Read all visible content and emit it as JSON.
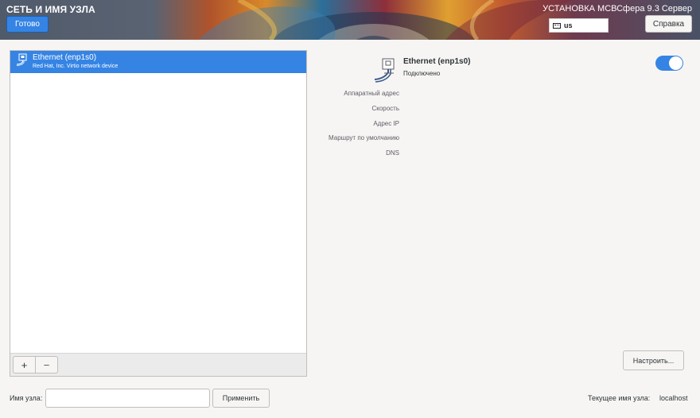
{
  "header": {
    "page_title": "СЕТЬ И ИМЯ УЗЛА",
    "done_label": "Готово",
    "product_title": "УСТАНОВКА МСВСфера 9.3 Сервер",
    "keyboard_layout": "us",
    "help_label": "Справка"
  },
  "devices": [
    {
      "name": "Ethernet (enp1s0)",
      "description": "Red Hat, Inc. Virtio network device",
      "selected": true
    }
  ],
  "list_toolbar": {
    "add_label": "+",
    "remove_label": "−"
  },
  "detail": {
    "name": "Ethernet (enp1s0)",
    "status": "Подключено",
    "enabled": true,
    "properties": {
      "hardware_address": "Аппаратный адрес",
      "speed": "Скорость",
      "ip_address": "Адрес IP",
      "default_route": "Маршрут по умолчанию",
      "dns": "DNS"
    },
    "configure_label": "Настроить..."
  },
  "hostname": {
    "label": "Имя узла:",
    "value": "",
    "apply_label": "Применить",
    "current_label": "Текущее имя узла:",
    "current_value": "localhost"
  },
  "colors": {
    "accent": "#3584e4"
  }
}
